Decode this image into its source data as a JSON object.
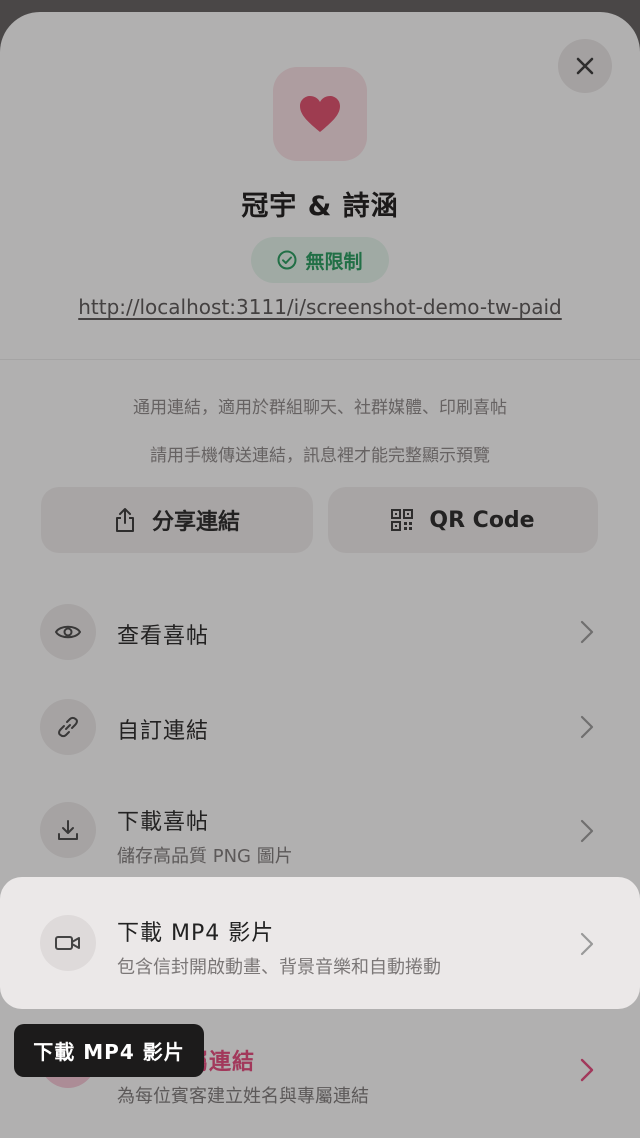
{
  "header": {
    "title": "冠宇 & 詩涵",
    "badge": "無限制",
    "url": "http://localhost:3111/i/screenshot-demo-tw-paid"
  },
  "hints": [
    "通用連結，適用於群組聊天、社群媒體、印刷喜帖",
    "請用手機傳送連結，訊息裡才能完整顯示預覽"
  ],
  "actions": {
    "share_label": "分享連結",
    "qr_label": "QR Code"
  },
  "rows": [
    {
      "label": "查看喜帖",
      "sub": ""
    },
    {
      "label": "自訂連結",
      "sub": ""
    },
    {
      "label": "下載喜帖",
      "sub": "儲存高品質 PNG 圖片"
    },
    {
      "label": "下載 MP4 影片",
      "sub": "包含信封開啟動畫、背景音樂和自動捲動"
    },
    {
      "label": "賓客專屬連結",
      "sub": "為每位賓客建立姓名與專屬連結"
    }
  ],
  "tooltip": "下載 MP4 影片",
  "colors": {
    "heart": "#e24a6a",
    "badge_text": "#1f9a5a",
    "accent_pink": "#e8447a"
  }
}
